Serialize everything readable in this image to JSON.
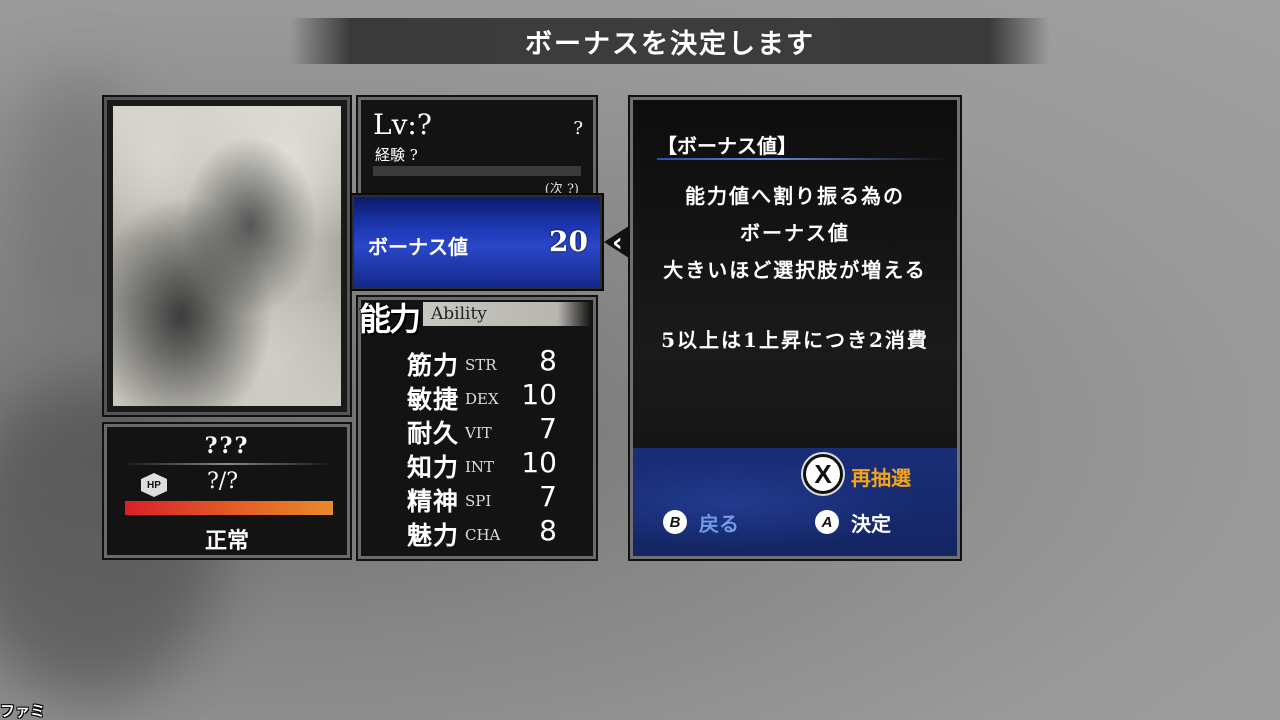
{
  "screen_title": "ボーナスを決定します",
  "character": {
    "name": "???",
    "hp_label": "HP",
    "hp_value": "?/?",
    "hp_fill_percent": 100,
    "status": "正常"
  },
  "level": {
    "lv": "Lv:?",
    "unknown": "?",
    "exp": "経験 ?",
    "next": "(次 ?)"
  },
  "bonus": {
    "label": "ボーナス値",
    "value": "20"
  },
  "ability": {
    "title_jp": "能力",
    "title_en": "Ability",
    "stats": [
      {
        "jp": "筋力",
        "en": "STR",
        "value": "8"
      },
      {
        "jp": "敏捷",
        "en": "DEX",
        "value": "10"
      },
      {
        "jp": "耐久",
        "en": "VIT",
        "value": "7"
      },
      {
        "jp": "知力",
        "en": "INT",
        "value": "10"
      },
      {
        "jp": "精神",
        "en": "SPI",
        "value": "7"
      },
      {
        "jp": "魅力",
        "en": "CHA",
        "value": "8"
      }
    ]
  },
  "help": {
    "title": "【ボーナス値】",
    "lines": [
      "能力値へ割り振る為の",
      "ボーナス値",
      "大きいほど選択肢が増える",
      "5以上は1上昇につき2消費"
    ],
    "reroll": {
      "button": "X",
      "label": "再抽選"
    },
    "back": {
      "button": "B",
      "label": "戻る"
    },
    "confirm": {
      "button": "A",
      "label": "決定"
    }
  },
  "colors": {
    "bonus_highlight": "#1d38b5",
    "reroll_label": "#f2a51c",
    "back_label": "#6f9be8",
    "hp_bar_start": "#d8202a",
    "hp_bar_end": "#e88a2a"
  },
  "watermark": "ファミ通.com"
}
